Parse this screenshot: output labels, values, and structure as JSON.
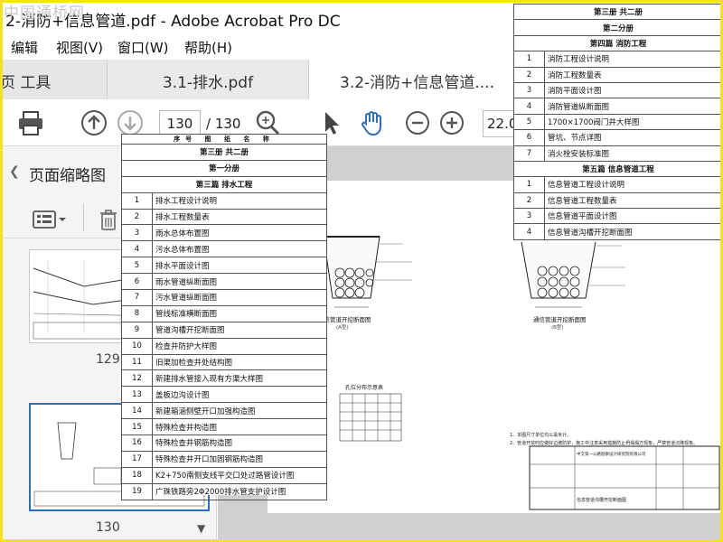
{
  "window": {
    "title": "2-消防+信息管道.pdf - Adobe Acrobat Pro DC",
    "watermark": "中国通桥网"
  },
  "menu": {
    "items": [
      "编辑",
      "视图(V)",
      "窗口(W)",
      "帮助(H)"
    ]
  },
  "tabs": [
    {
      "label": "页  工具"
    },
    {
      "label": "3.1-排水.pdf"
    },
    {
      "label": "3.2-消防+信息管道...."
    }
  ],
  "toolbar": {
    "current_page": "130",
    "total_pages": "/ 130",
    "zoom": "22.0"
  },
  "sidebar": {
    "title": "页面缩略图",
    "thumbnails": [
      {
        "page": "129"
      },
      {
        "page": "130"
      }
    ]
  },
  "index_left": {
    "header": "序号    图 纸 名 称",
    "rows": [
      {
        "no": "",
        "name": "第三册 共二册",
        "section": true
      },
      {
        "no": "",
        "name": "第一分册",
        "section": true
      },
      {
        "no": "",
        "name": "第三篇 排水工程",
        "section": true
      },
      {
        "no": "1",
        "name": "排水工程设计说明"
      },
      {
        "no": "2",
        "name": "排水工程数量表"
      },
      {
        "no": "3",
        "name": "雨水总体布置图"
      },
      {
        "no": "4",
        "name": "污水总体布置图"
      },
      {
        "no": "5",
        "name": "排水平面设计图"
      },
      {
        "no": "6",
        "name": "雨水管道纵断面图"
      },
      {
        "no": "7",
        "name": "污水管道纵断面图"
      },
      {
        "no": "8",
        "name": "管线标准横断面图"
      },
      {
        "no": "9",
        "name": "管道沟槽开挖断面图"
      },
      {
        "no": "10",
        "name": "检查井防护大样图"
      },
      {
        "no": "11",
        "name": "旧渠加检查井处结构图"
      },
      {
        "no": "12",
        "name": "新建排水管接入现有方渠大样图"
      },
      {
        "no": "13",
        "name": "盖板边沟设计图"
      },
      {
        "no": "14",
        "name": "新建箱涵侧壁开口加强构造图"
      },
      {
        "no": "15",
        "name": "特殊检查井构造图"
      },
      {
        "no": "16",
        "name": "特殊检查井钢筋构造图"
      },
      {
        "no": "17",
        "name": "特殊检查井开口加固钢筋构造图"
      },
      {
        "no": "18",
        "name": "K2+750南侧支线平交口处过路管设计图"
      },
      {
        "no": "19",
        "name": "广珠铁路旁2Φ2000排水管支护设计图"
      }
    ]
  },
  "index_right": {
    "rows": [
      {
        "no": "",
        "name": "第三册 共二册",
        "section": true
      },
      {
        "no": "",
        "name": "第二分册",
        "section": true
      },
      {
        "no": "",
        "name": "第四篇 消防工程",
        "section": true
      },
      {
        "no": "1",
        "name": "消防工程设计说明"
      },
      {
        "no": "2",
        "name": "消防工程数量表"
      },
      {
        "no": "3",
        "name": "消防平面设计图"
      },
      {
        "no": "4",
        "name": "消防管道纵断面图"
      },
      {
        "no": "5",
        "name": "1700×1700阀门井大样图"
      },
      {
        "no": "6",
        "name": "管坑、节点详图"
      },
      {
        "no": "7",
        "name": "消火栓安装标准图"
      },
      {
        "no": "",
        "name": "第五篇 信息管道工程",
        "section": true
      },
      {
        "no": "1",
        "name": "信息管道工程设计说明"
      },
      {
        "no": "2",
        "name": "信息管道工程数量表"
      },
      {
        "no": "3",
        "name": "信息管道平面设计图"
      },
      {
        "no": "4",
        "name": "信息管道沟槽开挖断面图"
      }
    ]
  },
  "drawing": {
    "caption_left": "通信管道开挖断面图",
    "caption_left_sub": "(A型)",
    "caption_right": "通信管道开挖断面图",
    "caption_right_sub": "(B型)",
    "table_title": "孔位分布示意表",
    "table_cols": [
      "A",
      "B",
      "C",
      "D"
    ],
    "table_rows": [
      [
        "1",
        "移动",
        "联通",
        "电信",
        "电信"
      ],
      [
        "2",
        "移动",
        "联通",
        "铁通",
        "电信"
      ],
      [
        "3",
        "移动",
        "联通",
        "铁通",
        "电信"
      ],
      [
        "4",
        "预留",
        "预留",
        "预留",
        "预留"
      ]
    ],
    "notes": [
      "1、本图尺寸单位均以毫米计。",
      "2、管道开挖时应做好边坡防护，施工中注意采用措施防止坍塌塌方现象，严禁管道沉降现象。"
    ],
    "company_left": "中交第一公路勘察设计研究院有限公司",
    "company_right": "中交第一公路勘察设计研究院有限公司",
    "drawing_name": "信息管道沟槽开挖断面图"
  },
  "colors": {
    "frame": "#f2e31a",
    "toolbar_icon": "#2f6fb3",
    "tab_bg": "#e6e6e6"
  }
}
